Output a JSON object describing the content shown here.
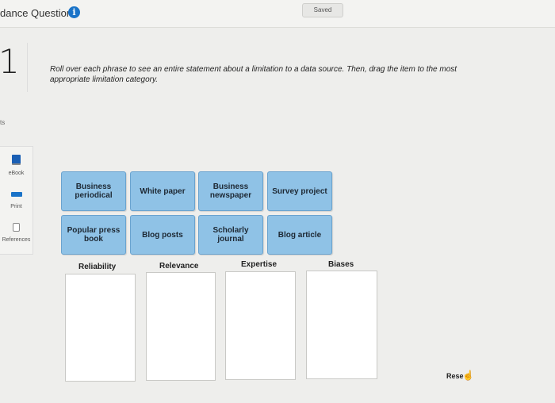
{
  "header": {
    "title": "dance Question",
    "saved_label": "Saved"
  },
  "question": {
    "number": "1",
    "points_label": "ts",
    "instructions": "Roll over each phrase to see an entire statement about a limitation to a data source. Then, drag the item to the most appropriate limitation category."
  },
  "tools": {
    "ebook": "eBook",
    "print": "Print",
    "references": "References"
  },
  "items": [
    "Business periodical",
    "White paper",
    "Business newspaper",
    "Survey project",
    "Popular press book",
    "Blog posts",
    "Scholarly journal",
    "Blog article"
  ],
  "categories": [
    "Reliability",
    "Relevance",
    "Expertise",
    "Biases"
  ],
  "reset_label": "Rese",
  "colors": {
    "tile": "#8fc2e6",
    "accent": "#1a73c8"
  }
}
